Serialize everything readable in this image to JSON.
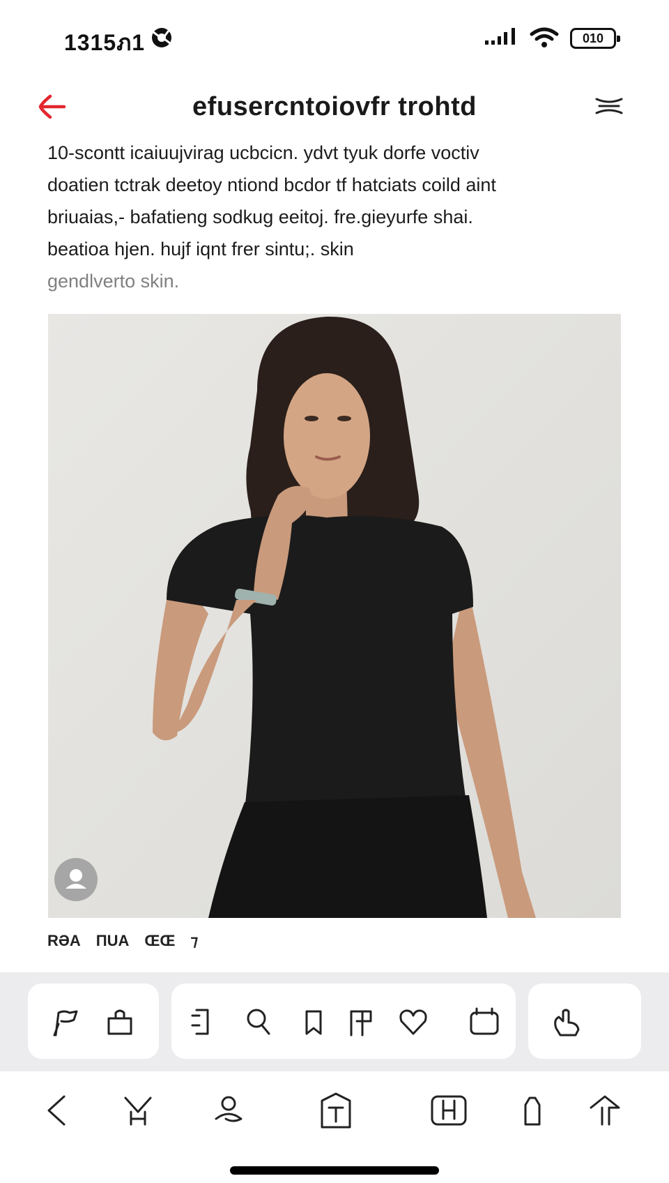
{
  "status_bar": {
    "time": "1315ภ1",
    "battery": "010"
  },
  "header": {
    "title": "efusercntoiovfr trohtd",
    "accent_color": "#e3262f"
  },
  "description": {
    "lines": [
      "10-scontt icaiuujvirag ucbcicn. ydvt tyuk dorfe voctiv",
      "doatien tctrak deetoy  ntiond bcdor tf hatciats coild aint",
      "briuaias,- bafatieng sodkug eeitoj. fre.gieyurfe shai.",
      "beatioa hjen. hujf iqnt frer sintu;. skin"
    ],
    "muted_line": "gendlverto skin."
  },
  "photo": {
    "subject": "model-in-black-tshirt"
  },
  "tags": [
    "RƏA",
    "ΠUA",
    "ŒŒ",
    "⁊"
  ],
  "action_cards": {
    "card1": [
      "share-icon",
      "bag-icon"
    ],
    "card2": [
      "copy-icon",
      "search-icon",
      "tag-icon",
      "filter-icon",
      "heart-icon",
      "calendar-icon"
    ],
    "card3": [
      "hand-icon"
    ]
  },
  "bottom_nav": [
    "back-icon",
    "scissors-icon",
    "profile-icon",
    "text-icon",
    "layout-icon",
    "bottle-icon",
    "forward-icon"
  ]
}
